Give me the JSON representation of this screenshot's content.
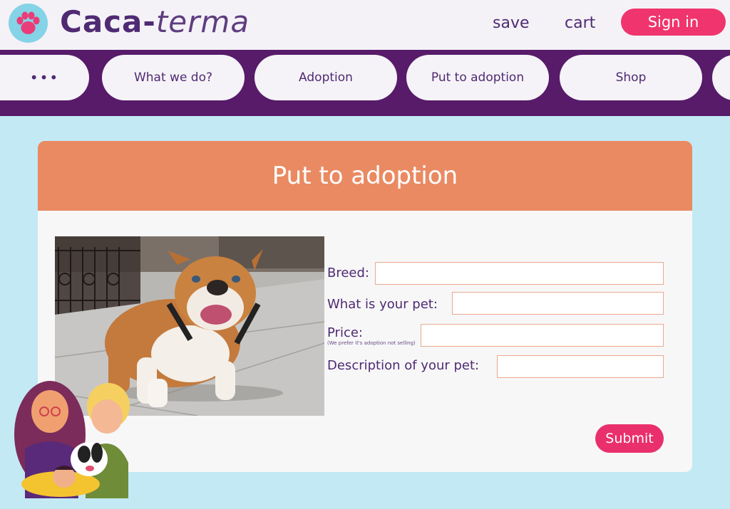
{
  "brand": {
    "name_part1": "Caca-",
    "name_part2": "terma"
  },
  "header": {
    "save": "save",
    "cart": "cart",
    "signin": "Sign in"
  },
  "nav": {
    "more": "•••",
    "items": [
      "What we do?",
      "Adoption",
      "Put to adoption",
      "Shop"
    ]
  },
  "form": {
    "title": "Put to adoption",
    "breed_label": "Breed:",
    "pet_label": "What is your pet:",
    "price_label": "Price:",
    "price_note": "(We prefer it's adoption not selling)",
    "description_label": "Description of your pet:",
    "submit": "Submit",
    "values": {
      "breed": "",
      "pet": "",
      "price": "",
      "description": ""
    }
  },
  "colors": {
    "primary_purple": "#571b6a",
    "text_purple": "#4f2a73",
    "accent_pink": "#f0346e",
    "header_orange": "#ea8a62",
    "background": "#c3e9f5"
  }
}
